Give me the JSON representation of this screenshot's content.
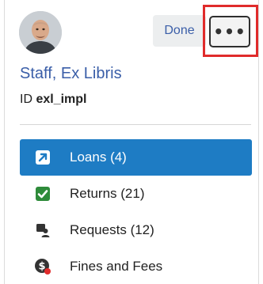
{
  "user": {
    "name": "Staff, Ex Libris",
    "id_label": "ID",
    "id_value": "exl_impl"
  },
  "header": {
    "done_label": "Done",
    "more_label": "•••"
  },
  "nav": {
    "items": [
      {
        "label": "Loans",
        "count": "(4)",
        "icon": "arrow-out-icon",
        "active": true
      },
      {
        "label": "Returns",
        "count": "(21)",
        "icon": "checkmark-icon",
        "active": false
      },
      {
        "label": "Requests",
        "count": "(12)",
        "icon": "requests-icon",
        "active": false
      },
      {
        "label": "Fines and Fees",
        "count": "",
        "icon": "fines-icon",
        "active": false
      }
    ]
  },
  "colors": {
    "accent": "#1e7cc4",
    "link": "#3a5ea8",
    "highlight": "#e02b2b",
    "returns_icon": "#2e8b3a"
  }
}
